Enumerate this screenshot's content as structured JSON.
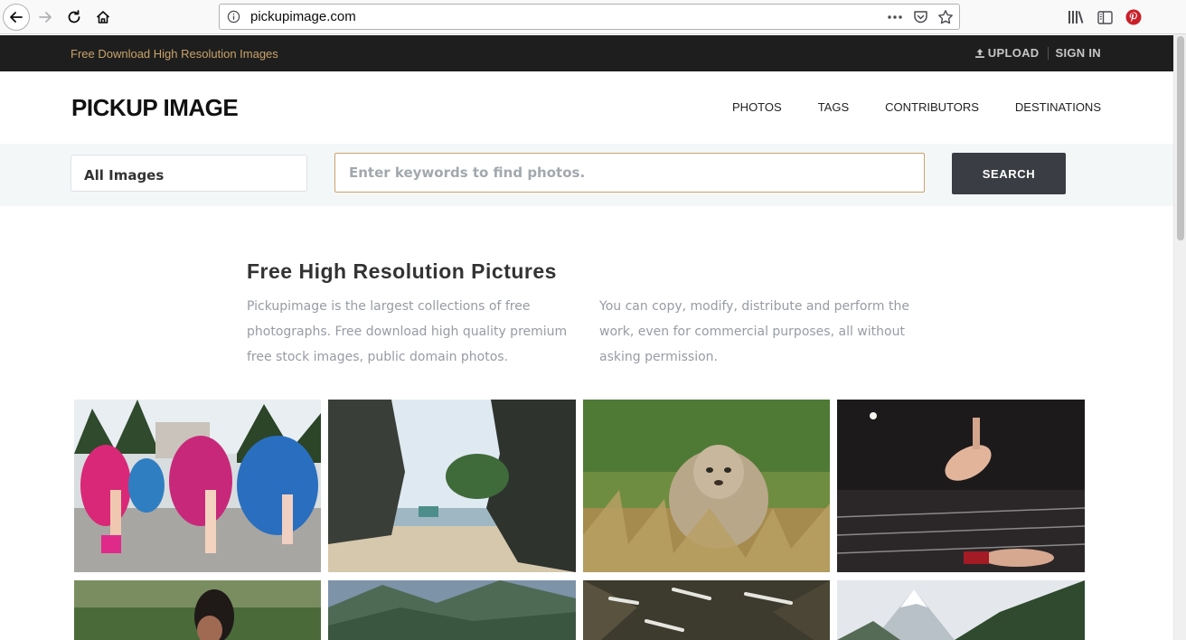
{
  "browser": {
    "url": "pickupimage.com",
    "icons": {
      "back": "back-arrow-icon",
      "forward": "forward-arrow-icon",
      "reload": "reload-icon",
      "home": "home-icon",
      "info": "info-icon",
      "more": "more-actions-icon",
      "pocket": "pocket-icon",
      "bookmark": "bookmark-star-icon",
      "library": "library-icon",
      "sidebar": "sidebar-icon",
      "pinterest": "pinterest-icon"
    }
  },
  "topbar": {
    "tagline": "Free Download High Resolution Images",
    "upload_label": "UPLOAD",
    "signin_label": "SIGN IN"
  },
  "header": {
    "logo": "PICKUP IMAGE",
    "nav": [
      "PHOTOS",
      "TAGS",
      "CONTRIBUTORS",
      "DESTINATIONS"
    ]
  },
  "search": {
    "category": "All Images",
    "placeholder": "Enter keywords to find photos.",
    "button_label": "SEARCH"
  },
  "intro": {
    "title": "Free High Resolution Pictures",
    "left_text": "Pickupimage is the largest collections of free photographs. Free download high quality premium free stock images, public domain photos.",
    "right_text": "You can copy, modify, distribute and perform the work, even for commercial purposes, all without asking permission."
  },
  "colors": {
    "topbar_bg": "#1e1e1e",
    "tagline": "#c9a36a",
    "search_border": "#c9a36a",
    "search_button": "#3a3d43",
    "search_band_bg": "#f4f7f8"
  },
  "photos": [
    {
      "subject": "carnival-dancers"
    },
    {
      "subject": "rocky-beach"
    },
    {
      "subject": "cheetah-cub"
    },
    {
      "subject": "wrestling-ring"
    },
    {
      "subject": "woman-forest"
    },
    {
      "subject": "mountain-valley"
    },
    {
      "subject": "snowy-forest"
    },
    {
      "subject": "snowy-peak"
    }
  ]
}
